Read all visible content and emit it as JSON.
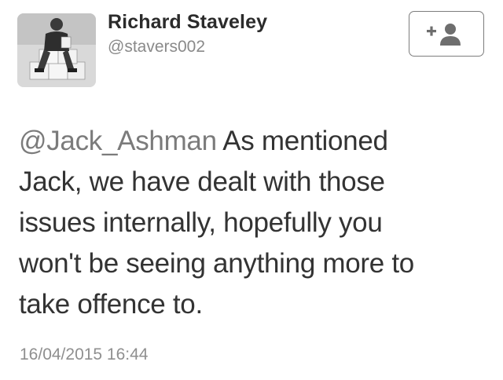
{
  "profile": {
    "display_name": "Richard Staveley",
    "handle": "@stavers002"
  },
  "follow_button": {
    "icon": "add-user-icon"
  },
  "tweet": {
    "mention": "@Jack_Ashman",
    "line1_rest": " As mentioned",
    "line2": "Jack, we have dealt with those",
    "line3": "issues internally, hopefully you",
    "line4": "won't be seeing anything more to",
    "line5": "take offence to."
  },
  "timestamp": "16/04/2015 16:44"
}
